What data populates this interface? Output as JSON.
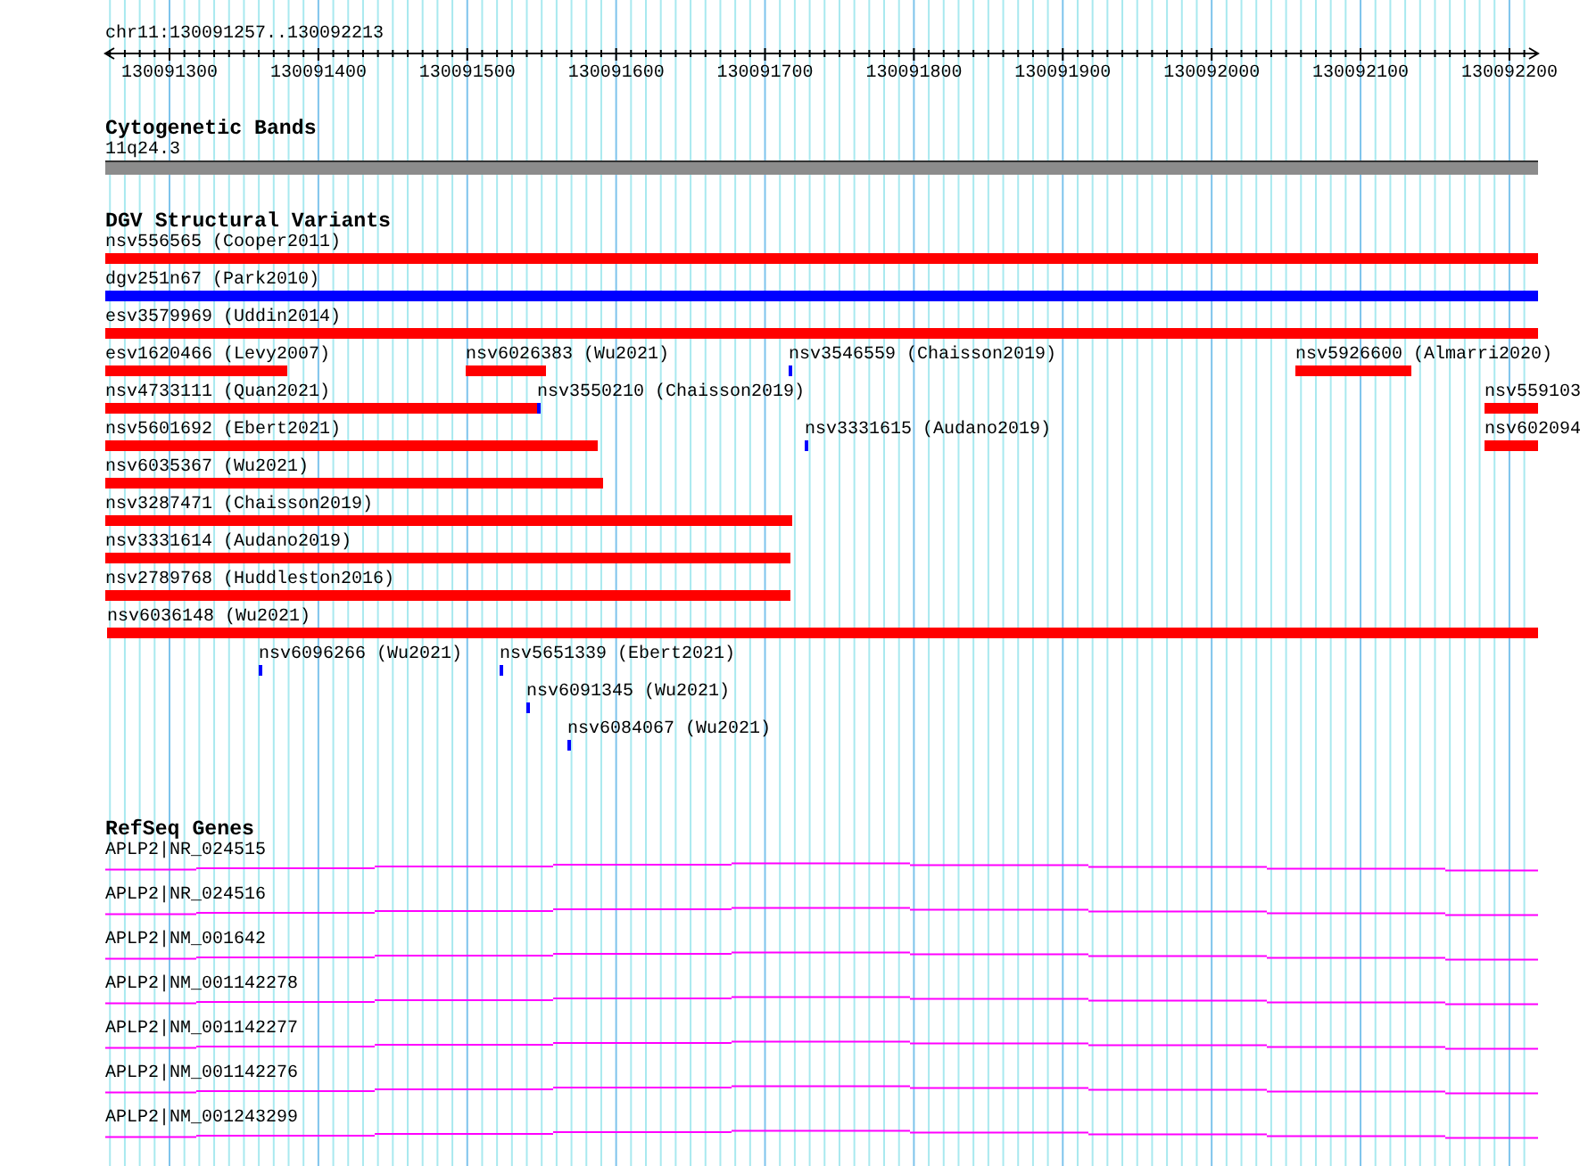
{
  "location": "chr11:130091257..130092213",
  "ruler": {
    "ticks": [
      "130091300",
      "130091400",
      "130091500",
      "130091600",
      "130091700",
      "130091800",
      "130091900",
      "130092000",
      "130092100",
      "130092200"
    ]
  },
  "cytogenetic_bands": {
    "title": "Cytogenetic Bands",
    "bands": [
      {
        "label": "11q24.3"
      }
    ]
  },
  "structural_variants": {
    "title": "DGV Structural Variants",
    "rows": [
      {
        "features": [
          {
            "label": "nsv556565 (Cooper2011)",
            "color": "#ff0000"
          }
        ]
      },
      {
        "features": [
          {
            "label": "dgv251n67 (Park2010)",
            "color": "#0000ff"
          }
        ]
      },
      {
        "features": [
          {
            "label": "esv3579969 (Uddin2014)",
            "color": "#ff0000"
          }
        ]
      },
      {
        "features": [
          {
            "label": "esv1620466 (Levy2007)",
            "color": "#ff0000"
          },
          {
            "label": "nsv6026383 (Wu2021)",
            "color": "#ff0000"
          },
          {
            "label": "nsv3546559 (Chaisson2019)",
            "color": "#0000ff"
          },
          {
            "label": "nsv5926600 (Almarri2020)",
            "color": "#ff0000"
          }
        ]
      },
      {
        "features": [
          {
            "label": "nsv4733111 (Quan2021)",
            "color": "#ff0000"
          },
          {
            "label": "nsv3550210 (Chaisson2019)",
            "color": "#0000ff"
          },
          {
            "label": "nsv559103",
            "color": "#ff0000"
          }
        ]
      },
      {
        "features": [
          {
            "label": "nsv5601692 (Ebert2021)",
            "color": "#ff0000"
          },
          {
            "label": "nsv3331615 (Audano2019)",
            "color": "#0000ff"
          },
          {
            "label": "nsv602094",
            "color": "#ff0000"
          }
        ]
      },
      {
        "features": [
          {
            "label": "nsv6035367 (Wu2021)",
            "color": "#ff0000"
          }
        ]
      },
      {
        "features": [
          {
            "label": "nsv3287471 (Chaisson2019)",
            "color": "#ff0000"
          }
        ]
      },
      {
        "features": [
          {
            "label": "nsv3331614 (Audano2019)",
            "color": "#ff0000"
          }
        ]
      },
      {
        "features": [
          {
            "label": "nsv2789768 (Huddleston2016)",
            "color": "#ff0000"
          }
        ]
      },
      {
        "features": [
          {
            "label": "nsv6036148 (Wu2021)",
            "color": "#ff0000"
          }
        ]
      },
      {
        "features": [
          {
            "label": "nsv6096266 (Wu2021)",
            "color": "#0000ff"
          },
          {
            "label": "nsv5651339 (Ebert2021)",
            "color": "#0000ff"
          }
        ]
      },
      {
        "features": [
          {
            "label": "nsv6091345 (Wu2021)",
            "color": "#0000ff"
          }
        ]
      },
      {
        "features": [
          {
            "label": "nsv6084067 (Wu2021)",
            "color": "#0000ff"
          }
        ]
      }
    ]
  },
  "refseq_genes": {
    "title": "RefSeq Genes",
    "transcripts": [
      {
        "label": "APLP2|NR_024515"
      },
      {
        "label": "APLP2|NR_024516"
      },
      {
        "label": "APLP2|NM_001642"
      },
      {
        "label": "APLP2|NM_001142278"
      },
      {
        "label": "APLP2|NM_001142277"
      },
      {
        "label": "APLP2|NM_001142276"
      },
      {
        "label": "APLP2|NM_001243299"
      }
    ]
  }
}
